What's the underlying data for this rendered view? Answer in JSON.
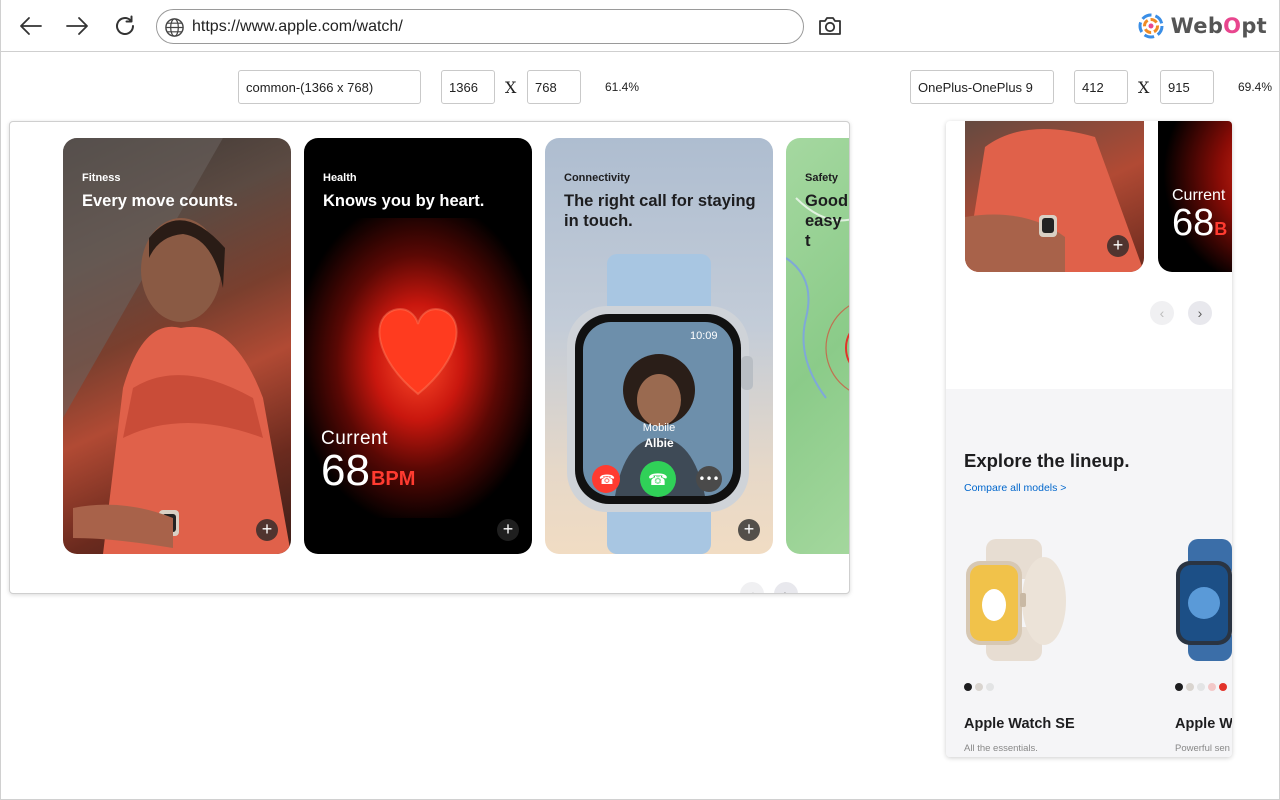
{
  "browser": {
    "url": "https://www.apple.com/watch/",
    "brand": {
      "name_prefix": "Web",
      "name_o": "O",
      "name_suffix": "pt"
    }
  },
  "desktop_device": {
    "name": "common-(1366 x 768)",
    "width": "1366",
    "height": "768",
    "x": "X",
    "zoom": "61.4%"
  },
  "mobile_device": {
    "name": "OnePlus-OnePlus 9",
    "width": "412",
    "height": "915",
    "x": "X",
    "zoom": "69.4%"
  },
  "cards": {
    "fitness": {
      "eyebrow": "Fitness",
      "headline": "Every move counts."
    },
    "health": {
      "eyebrow": "Health",
      "headline": "Knows you by heart.",
      "hr_label": "Current",
      "hr_value": "68",
      "hr_unit": "BPM"
    },
    "connectivity": {
      "eyebrow": "Connectivity",
      "headline": "The right call for staying in touch.",
      "time": "10:09",
      "caller_type": "Mobile",
      "caller_name": "Albie"
    },
    "safety": {
      "eyebrow": "Safety",
      "headline": "Good easy t"
    }
  },
  "plus_label": "+",
  "mobile": {
    "hr_label": "Current",
    "hr_value": "68",
    "hr_unit": "B",
    "explore_title": "Explore the lineup.",
    "compare_link": "Compare all models >",
    "products": [
      {
        "name": "Apple Watch SE",
        "desc": "All the essentials.",
        "dot_colors": [
          "#1d1d1f",
          "#d9d4cf",
          "#e3e4e5"
        ]
      },
      {
        "name": "Apple Wa",
        "desc": "Powerful sen",
        "dot_colors": [
          "#1d1d1f",
          "#d9d4cf",
          "#e3e4e5",
          "#f3c8c8",
          "#e2332a"
        ]
      }
    ]
  },
  "colors": {
    "heart": "#ff3b30",
    "link": "#0066cc",
    "brand_o": "#e8468e"
  }
}
